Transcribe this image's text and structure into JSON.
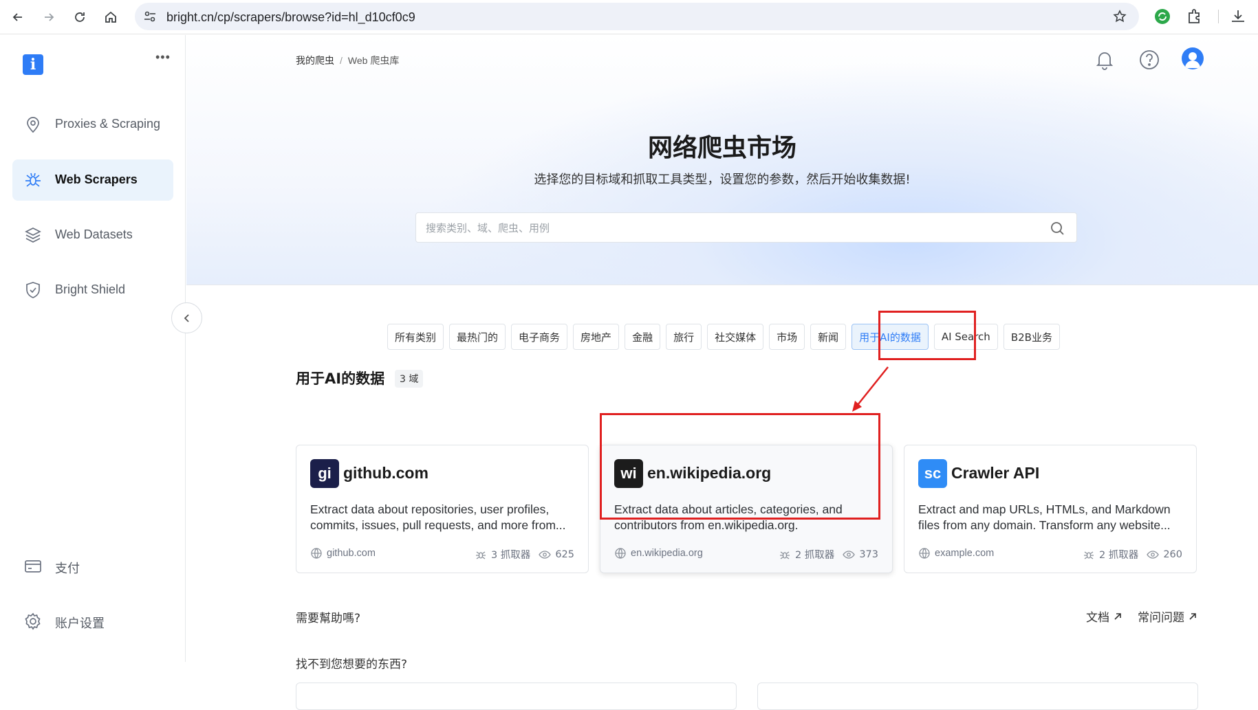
{
  "browser": {
    "url": "bright.cn/cp/scrapers/browse?id=hl_d10cf0c9"
  },
  "sidebar": {
    "more_label": "•••",
    "items": [
      {
        "label": "Proxies & Scraping",
        "icon": "location-pin-icon"
      },
      {
        "label": "Web Scrapers",
        "icon": "spider-icon"
      },
      {
        "label": "Web Datasets",
        "icon": "layers-icon"
      },
      {
        "label": "Bright Shield",
        "icon": "shield-icon"
      }
    ],
    "bottom": [
      {
        "label": "支付",
        "icon": "credit-card-icon"
      },
      {
        "label": "账户设置",
        "icon": "gear-icon"
      }
    ]
  },
  "breadcrumb": {
    "root": "我的爬虫",
    "separator": "/",
    "current": "Web 爬虫库"
  },
  "hero": {
    "title": "网络爬虫市场",
    "subtitle": "选择您的目标域和抓取工具类型，设置您的参数，然后开始收集数据!",
    "search_placeholder": "搜索类别、域、爬虫、用例"
  },
  "tabs": [
    "所有类别",
    "最热门的",
    "电子商务",
    "房地产",
    "金融",
    "旅行",
    "社交媒体",
    "市场",
    "新闻",
    "用于AI的数据",
    "AI Search",
    "B2B业务"
  ],
  "active_tab": "用于AI的数据",
  "section": {
    "title": "用于AI的数据",
    "count": "3 域"
  },
  "cards": [
    {
      "badge": "gi",
      "badge_color": "#1b1f4a",
      "name": "github.com",
      "desc": "Extract data about repositories, user profiles, commits, issues, pull requests, and more from...",
      "domain": "github.com",
      "scrapers": "3 抓取器",
      "views": "625"
    },
    {
      "badge": "wi",
      "badge_color": "#1c1c1c",
      "name": "en.wikipedia.org",
      "desc": "Extract data about articles, categories, and contributors from en.wikipedia.org.",
      "domain": "en.wikipedia.org",
      "scrapers": "2 抓取器",
      "views": "373"
    },
    {
      "badge": "sc",
      "badge_color": "#2f8cf6",
      "name": "Crawler API",
      "desc": "Extract and map URLs, HTMLs, and Markdown files from any domain. Transform any website...",
      "domain": "example.com",
      "scrapers": "2 抓取器",
      "views": "260"
    }
  ],
  "help": {
    "question": "需要幫助嗎?",
    "docs": "文档",
    "faq": "常问问题",
    "cant_find": "找不到您想要的东西?"
  },
  "colors": {
    "accent": "#2f7df6",
    "annotation_red": "#e02020"
  }
}
